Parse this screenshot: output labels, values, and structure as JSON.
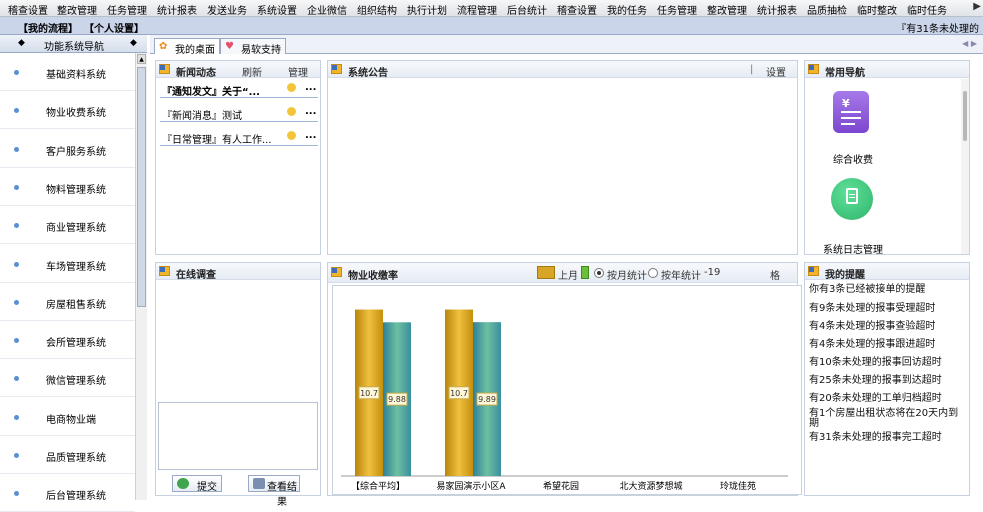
{
  "top_menu": {
    "items": [
      "稽查设置",
      "整改管理",
      "任务管理",
      "统计报表",
      "发送业务",
      "系统设置",
      "企业微信",
      "组织结构",
      "执行计划",
      "流程管理",
      "后台统计",
      "稽查设置",
      "我的任务",
      "任务管理",
      "整改管理",
      "统计报表",
      "品质抽检",
      "临时整改",
      "临时任务"
    ],
    "more_arrow": "▶"
  },
  "sub_bar": {
    "my_process": "【我的流程】",
    "personal": "【个人设置】",
    "ticker": "『有31条未处理的"
  },
  "sidebar": {
    "title": "功能系统导航",
    "items": [
      "基础资料系统",
      "物业收费系统",
      "客户服务系统",
      "物料管理系统",
      "商业管理系统",
      "车场管理系统",
      "房屋租售系统",
      "会所管理系统",
      "微信管理系统",
      "电商物业端",
      "品质管理系统",
      "后台管理系统"
    ]
  },
  "tabs": [
    {
      "label": "我的桌面"
    },
    {
      "label": "易软支持"
    }
  ],
  "news": {
    "title": "新闻动态",
    "refresh": "刷新",
    "manage": "管理",
    "rows": [
      {
        "text": "『通知发文』关于“...",
        "more": "...",
        "bold": true
      },
      {
        "text": "『新闻消息』测试",
        "more": "..."
      },
      {
        "text": "『日常管理』有人工作...",
        "more": "..."
      }
    ]
  },
  "announcement": {
    "title": "系统公告",
    "settings": "设置"
  },
  "guide": {
    "title": "常用导航",
    "items": [
      {
        "label": "综合收费",
        "icon": "receipt-icon",
        "color": "#8a57d8"
      },
      {
        "label": "系统日志管理",
        "icon": "clipboard-icon",
        "color": "#3cc47c"
      }
    ]
  },
  "survey": {
    "title": "在线调查",
    "submit": "提交",
    "view_result": "查看结果"
  },
  "collection": {
    "title": "物业收缴率",
    "legend_last_month": "上月",
    "by_month": "按月统计",
    "by_year": "按年统计",
    "year_value": "-19",
    "cut_text": "格"
  },
  "chart_data": {
    "type": "bar",
    "categories": [
      "【综合平均】",
      "易家园演示小区A",
      "希望花园",
      "北大资源梦想城",
      "玲珑佳苑"
    ],
    "series": [
      {
        "name": "上月",
        "values": [
          10.7,
          10.7,
          0,
          0,
          0
        ],
        "color": "#d4a520"
      },
      {
        "values": [
          9.88,
          9.89,
          0,
          0,
          0
        ],
        "color": "#3f9aa8"
      }
    ],
    "value_labels": [
      [
        "10.7",
        "9.88"
      ],
      [
        "10.7",
        "9.89"
      ]
    ],
    "ylim": [
      0,
      11.7
    ],
    "grid": false,
    "legend": "top"
  },
  "reminders": {
    "title": "我的提醒",
    "items": [
      "你有3条已经被接单的提醒",
      "有9条未处理的报事受理超时",
      "有4条未处理的报事查验超时",
      "有4条未处理的报事跟进超时",
      "有10条未处理的报事回访超时",
      "有25条未处理的报事到达超时",
      "有20条未处理的工单归档超时",
      "有1个房屋出租状态将在20天内到期",
      "有31条未处理的报事完工超时"
    ]
  }
}
